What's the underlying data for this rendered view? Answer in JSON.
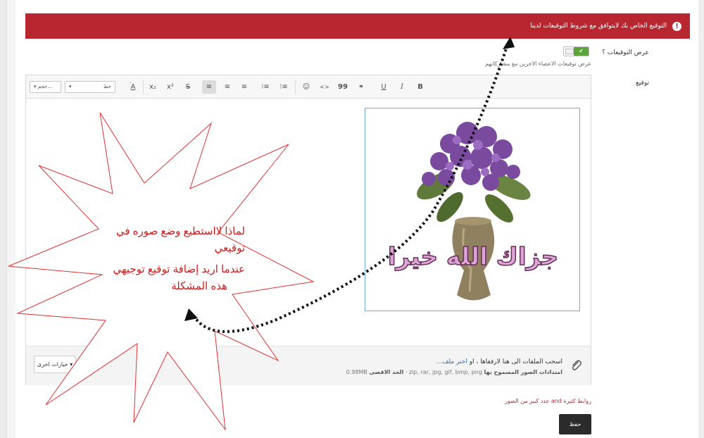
{
  "error": {
    "message": "التوقيع الخاص بك لايتوافق مع شروط التوقيعات لدينا",
    "icon": "alert-circle-icon"
  },
  "show_signatures": {
    "label": "عرض التوقيعات ؟",
    "toggle_on": "✔",
    "hint": "عرض توقيعات الاعضاء الاخرين مع مشاركاتهم"
  },
  "signature": {
    "label": "توقيع"
  },
  "toolbar": {
    "size_label": "حجم...",
    "font_label": "خط",
    "buttons": [
      "A",
      "x₂",
      "x²",
      "S",
      "≡",
      "≡",
      "≡",
      "⁝≡",
      "⁝≡",
      "☺",
      "<>",
      "99",
      "⚭",
      "U",
      "I",
      "B"
    ]
  },
  "attachments": {
    "drag_text": "اسحب الملفات الى هنا لارفقاها ، او",
    "choose_link": "اختر ملف...",
    "allowed_label": "امتدادات الصور المسموح بها",
    "allowed_types": "zip, rar, jpg, gif, bmp, png",
    "max_label": "الحد الاقصى",
    "max_size": "0.98MB",
    "more_button": "خيارات اخرى ▾"
  },
  "notice": "روابط كثيرة and عدد كبير من الصور",
  "save_button": "حفظ",
  "annotation": {
    "line1": "لماذا لااستطيع وضع صوره في",
    "line2": "توقيعي",
    "line3": "عندما اريد إضافة توقيع توجيهي",
    "line4": "هذه المشكلة"
  },
  "image_caption": "جزاك الله خيرا",
  "colors": {
    "error_bg": "#b8262f",
    "toggle_on": "#5aa43a",
    "annotation_red": "#cc1a1a",
    "save_bg": "#2b2b2b",
    "link": "#2a6db0"
  }
}
